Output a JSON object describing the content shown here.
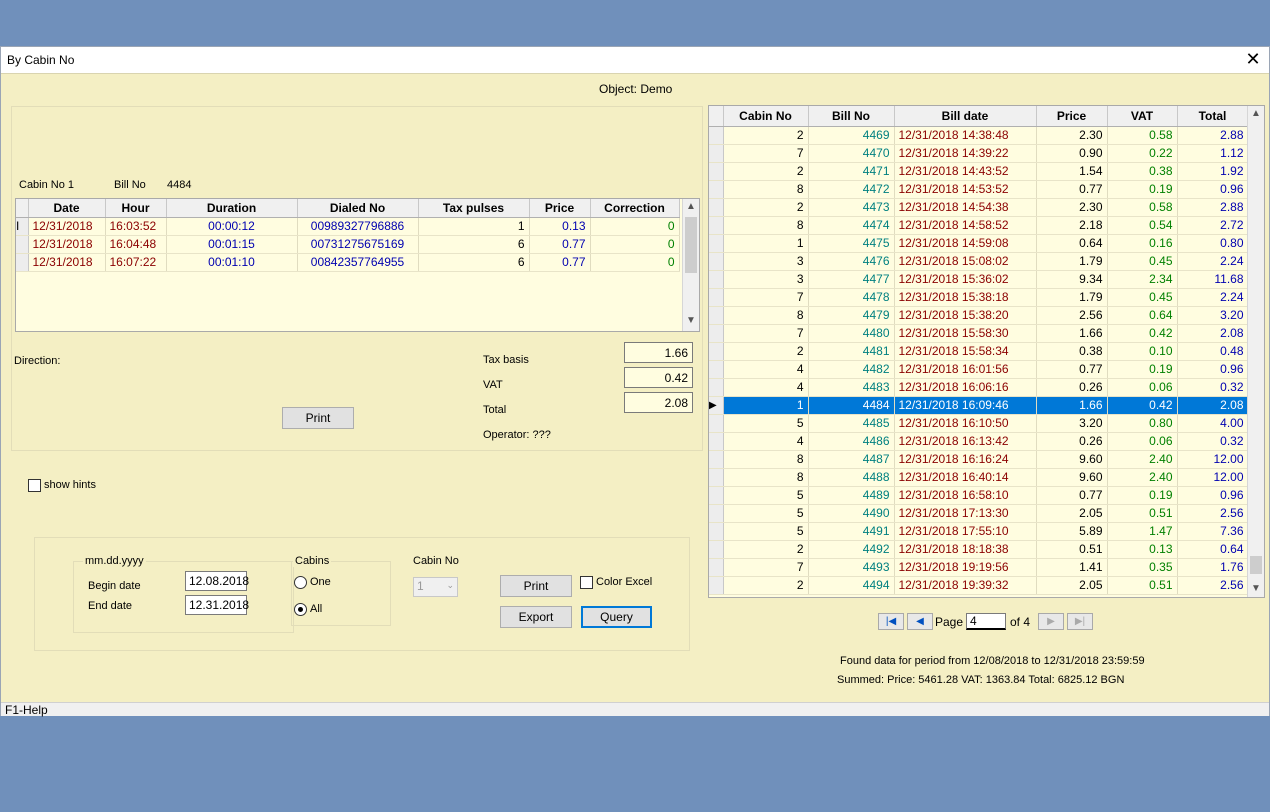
{
  "window": {
    "title": "By Cabin No",
    "close_glyph": "✕"
  },
  "object_label": "Object: Demo",
  "detail": {
    "cabin_label": "Cabin No 1",
    "bill_label": "Bill No",
    "bill_value": "4484",
    "calls_columns": [
      "Date",
      "Hour",
      "Duration",
      "Dialed No",
      "Tax pulses",
      "Price",
      "Correction"
    ],
    "calls": [
      [
        "12/31/2018",
        "16:03:52",
        "00:00:12",
        "00989327796886",
        "1",
        "0.13",
        "0"
      ],
      [
        "12/31/2018",
        "16:04:48",
        "00:01:15",
        "00731275675169",
        "6",
        "0.77",
        "0"
      ],
      [
        "12/31/2018",
        "16:07:22",
        "00:01:10",
        "00842357764955",
        "6",
        "0.77",
        "0"
      ]
    ],
    "direction_label": "Direction:",
    "tax_basis_label": "Tax basis",
    "tax_basis_value": "1.66",
    "vat_label": "VAT",
    "vat_value": "0.42",
    "total_label": "Total",
    "total_value": "2.08",
    "print_label": "Print",
    "operator_label": "Operator: ???"
  },
  "show_hints_label": "show hints",
  "filter": {
    "date_format_label": "mm.dd.yyyy",
    "begin_label": "Begin date",
    "begin_value": "12.08.2018",
    "end_label": "End date",
    "end_value": "12.31.2018",
    "cabins_label": "Cabins",
    "one_label": "One",
    "all_label": "All",
    "cabin_no_label": "Cabin No",
    "cabin_no_value": "1",
    "print_label": "Print",
    "color_excel_label": "Color Excel",
    "export_label": "Export",
    "query_label": "Query"
  },
  "bills": {
    "columns": [
      "Cabin No",
      "Bill No",
      "Bill date",
      "Price",
      "VAT",
      "Total"
    ],
    "selected_index": 15,
    "rows": [
      [
        "2",
        "4469",
        "12/31/2018 14:38:48",
        "2.30",
        "0.58",
        "2.88"
      ],
      [
        "7",
        "4470",
        "12/31/2018 14:39:22",
        "0.90",
        "0.22",
        "1.12"
      ],
      [
        "2",
        "4471",
        "12/31/2018 14:43:52",
        "1.54",
        "0.38",
        "1.92"
      ],
      [
        "8",
        "4472",
        "12/31/2018 14:53:52",
        "0.77",
        "0.19",
        "0.96"
      ],
      [
        "2",
        "4473",
        "12/31/2018 14:54:38",
        "2.30",
        "0.58",
        "2.88"
      ],
      [
        "8",
        "4474",
        "12/31/2018 14:58:52",
        "2.18",
        "0.54",
        "2.72"
      ],
      [
        "1",
        "4475",
        "12/31/2018 14:59:08",
        "0.64",
        "0.16",
        "0.80"
      ],
      [
        "3",
        "4476",
        "12/31/2018 15:08:02",
        "1.79",
        "0.45",
        "2.24"
      ],
      [
        "3",
        "4477",
        "12/31/2018 15:36:02",
        "9.34",
        "2.34",
        "11.68"
      ],
      [
        "7",
        "4478",
        "12/31/2018 15:38:18",
        "1.79",
        "0.45",
        "2.24"
      ],
      [
        "8",
        "4479",
        "12/31/2018 15:38:20",
        "2.56",
        "0.64",
        "3.20"
      ],
      [
        "7",
        "4480",
        "12/31/2018 15:58:30",
        "1.66",
        "0.42",
        "2.08"
      ],
      [
        "2",
        "4481",
        "12/31/2018 15:58:34",
        "0.38",
        "0.10",
        "0.48"
      ],
      [
        "4",
        "4482",
        "12/31/2018 16:01:56",
        "0.77",
        "0.19",
        "0.96"
      ],
      [
        "4",
        "4483",
        "12/31/2018 16:06:16",
        "0.26",
        "0.06",
        "0.32"
      ],
      [
        "1",
        "4484",
        "12/31/2018 16:09:46",
        "1.66",
        "0.42",
        "2.08"
      ],
      [
        "5",
        "4485",
        "12/31/2018 16:10:50",
        "3.20",
        "0.80",
        "4.00"
      ],
      [
        "4",
        "4486",
        "12/31/2018 16:13:42",
        "0.26",
        "0.06",
        "0.32"
      ],
      [
        "8",
        "4487",
        "12/31/2018 16:16:24",
        "9.60",
        "2.40",
        "12.00"
      ],
      [
        "8",
        "4488",
        "12/31/2018 16:40:14",
        "9.60",
        "2.40",
        "12.00"
      ],
      [
        "5",
        "4489",
        "12/31/2018 16:58:10",
        "0.77",
        "0.19",
        "0.96"
      ],
      [
        "5",
        "4490",
        "12/31/2018 17:13:30",
        "2.05",
        "0.51",
        "2.56"
      ],
      [
        "5",
        "4491",
        "12/31/2018 17:55:10",
        "5.89",
        "1.47",
        "7.36"
      ],
      [
        "2",
        "4492",
        "12/31/2018 18:18:38",
        "0.51",
        "0.13",
        "0.64"
      ],
      [
        "7",
        "4493",
        "12/31/2018 19:19:56",
        "1.41",
        "0.35",
        "1.76"
      ],
      [
        "2",
        "4494",
        "12/31/2018 19:39:32",
        "2.05",
        "0.51",
        "2.56"
      ]
    ]
  },
  "pager": {
    "page_label": "Page",
    "page_value": "4",
    "of_label": "of 4"
  },
  "summary": {
    "found_text": "Found data for period from 12/08/2018  to 12/31/2018 23:59:59",
    "summed_text": "Summed:  Price: 5461.28   VAT: 1363.84   Total: 6825.12 BGN"
  },
  "status_bar": {
    "help_text": "F1-Help"
  },
  "colors": {
    "desktop": "#7090bb",
    "window_bg": "#f4efc4",
    "selection": "#0078d7"
  }
}
